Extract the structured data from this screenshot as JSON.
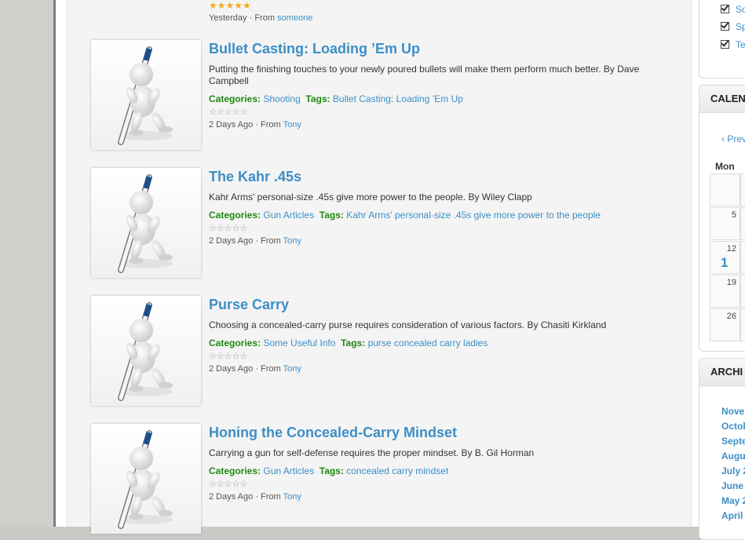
{
  "top_item": {
    "stars": "★★★★★",
    "time": "Yesterday",
    "from_label": "From",
    "author": "someone"
  },
  "posts": [
    {
      "title": "Bullet Casting: Loading ’Em Up",
      "desc": "Putting the finishing touches to your newly poured bullets will make them perform much better. By Dave Campbell",
      "categories_label": "Categories:",
      "category": "Shooting",
      "tags_label": "Tags:",
      "tags": "Bullet Casting: Loading ’Em Up",
      "stars": "☆☆☆☆☆",
      "time": "2 Days Ago",
      "from_label": "From",
      "author": "Tony"
    },
    {
      "title": "The Kahr .45s",
      "desc": "Kahr Arms' personal-size .45s give more power to the people. By Wiley Clapp",
      "categories_label": "Categories:",
      "category": "Gun Articles",
      "tags_label": "Tags:",
      "tags": "Kahr Arms' personal-size .45s give more power to the people",
      "stars": "☆☆☆☆☆",
      "time": "2 Days Ago",
      "from_label": "From",
      "author": "Tony"
    },
    {
      "title": "Purse Carry",
      "desc": "Choosing a concealed-carry purse requires consideration of various factors. By Chasiti Kirkland",
      "categories_label": "Categories:",
      "category": "Some Useful Info",
      "tags_label": "Tags:",
      "tags": "purse concealed carry ladies",
      "stars": "☆☆☆☆☆",
      "time": "2 Days Ago",
      "from_label": "From",
      "author": "Tony"
    },
    {
      "title": "Honing the Concealed-Carry Mindset",
      "desc": "Carrying a gun for self-defense requires the proper mindset. By B. Gil Horman",
      "categories_label": "Categories:",
      "category": "Gun Articles",
      "tags_label": "Tags:",
      "tags": "concealed carry mindset",
      "stars": "☆☆☆☆☆",
      "time": "2 Days Ago",
      "from_label": "From",
      "author": "Tony"
    }
  ],
  "sidebar": {
    "checks": [
      "So",
      "Sp",
      "Te"
    ],
    "calendar": {
      "title": "CALEN",
      "prev": "‹ Prev",
      "day_header": "Mon",
      "days": [
        "",
        "5",
        "12",
        "19",
        "26"
      ],
      "highlight": "1"
    },
    "archives": {
      "title": "ARCHI",
      "months": [
        "Nover",
        "Octob",
        "Septe",
        "Augu",
        "July 2",
        "June",
        "May 2",
        "April"
      ]
    }
  },
  "colors": {
    "link": "#3d8fc6",
    "label_green": "#1f8a12",
    "star_gold": "#f1a91c"
  }
}
